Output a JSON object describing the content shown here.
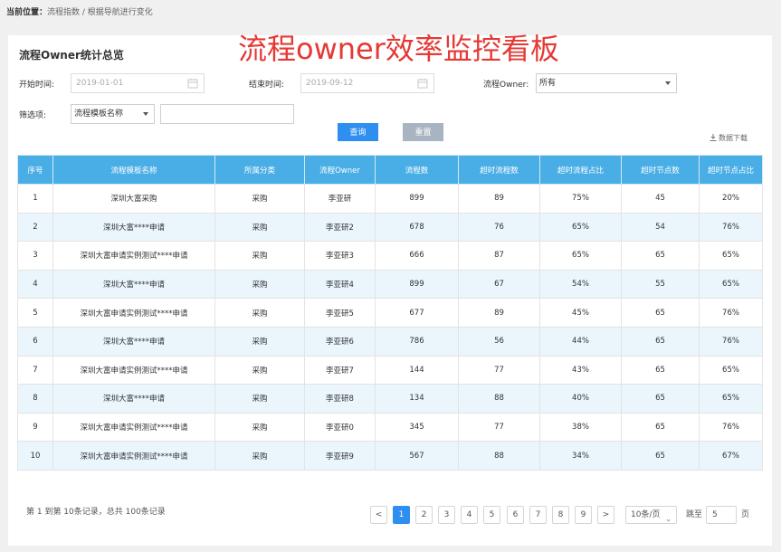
{
  "breadcrumb": {
    "label": "当前位置：",
    "path": "流程指数 / 根据导航进行变化"
  },
  "overlay_title": "流程owner效率监控看板",
  "panel": {
    "title": "流程Owner统计总览"
  },
  "filters": {
    "start_label": "开始时间:",
    "start_value": "2019-01-01",
    "end_label": "结束时间:",
    "end_value": "2019-09-12",
    "owner_label": "流程Owner:",
    "owner_value": "所有",
    "filter_label": "筛选项:",
    "filter_select": "流程模板名称",
    "filter_text": ""
  },
  "buttons": {
    "query": "查询",
    "reset": "重置",
    "download": "数据下载"
  },
  "table": {
    "columns": [
      "序号",
      "流程模板名称",
      "所属分类",
      "流程Owner",
      "流程数",
      "超时流程数",
      "超时流程占比",
      "超时节点数",
      "超时节点占比"
    ],
    "rows": [
      [
        "1",
        "深圳大富采购",
        "采购",
        "李亚研",
        "899",
        "89",
        "75%",
        "45",
        "20%"
      ],
      [
        "2",
        "深圳大富****申请",
        "采购",
        "李亚研2",
        "678",
        "76",
        "65%",
        "54",
        "76%"
      ],
      [
        "3",
        "深圳大富申请实例测试****申请",
        "采购",
        "李亚研3",
        "666",
        "87",
        "65%",
        "65",
        "65%"
      ],
      [
        "4",
        "深圳大富****申请",
        "采购",
        "李亚研4",
        "899",
        "67",
        "54%",
        "55",
        "65%"
      ],
      [
        "5",
        "深圳大富申请实例测试****申请",
        "采购",
        "李亚研5",
        "677",
        "89",
        "45%",
        "65",
        "76%"
      ],
      [
        "6",
        "深圳大富****申请",
        "采购",
        "李亚研6",
        "786",
        "56",
        "44%",
        "65",
        "76%"
      ],
      [
        "7",
        "深圳大富申请实例测试****申请",
        "采购",
        "李亚研7",
        "144",
        "77",
        "43%",
        "65",
        "65%"
      ],
      [
        "8",
        "深圳大富****申请",
        "采购",
        "李亚研8",
        "134",
        "88",
        "40%",
        "65",
        "65%"
      ],
      [
        "9",
        "深圳大富申请实例测试****申请",
        "采购",
        "李亚研0",
        "345",
        "77",
        "38%",
        "65",
        "76%"
      ],
      [
        "10",
        "深圳大富申请实例测试****申请",
        "采购",
        "李亚研9",
        "567",
        "88",
        "34%",
        "65",
        "67%"
      ]
    ]
  },
  "pagination": {
    "summary": "第 1 到第 10条记录，总共 100条记录",
    "prev": "<",
    "next": ">",
    "pages": [
      "1",
      "2",
      "3",
      "4",
      "5",
      "6",
      "7",
      "8",
      "9"
    ],
    "page_size": "10条/页",
    "jump_label": "跳至",
    "jump_value": "5",
    "jump_unit": "页"
  }
}
